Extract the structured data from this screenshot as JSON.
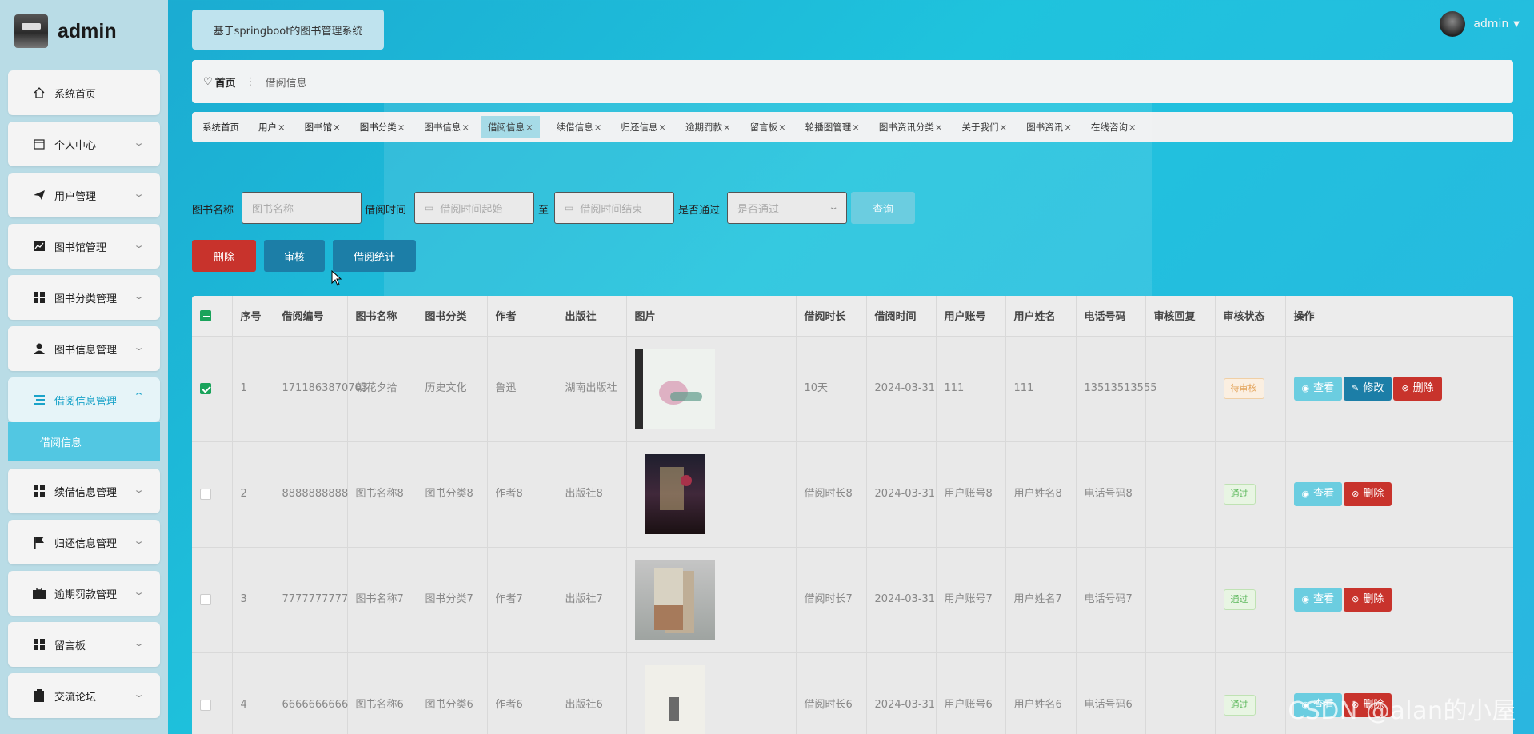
{
  "brand": {
    "name": "admin"
  },
  "header": {
    "system_title": "基于springboot的图书管理系统",
    "user_name": "admin"
  },
  "sidebar": {
    "items": [
      {
        "label": "系统首页",
        "icon": "home-icon"
      },
      {
        "label": "个人中心",
        "icon": "calendar-icon"
      },
      {
        "label": "用户管理",
        "icon": "send-icon"
      },
      {
        "label": "图书馆管理",
        "icon": "chart-icon"
      },
      {
        "label": "图书分类管理",
        "icon": "grid-icon"
      },
      {
        "label": "图书信息管理",
        "icon": "user-icon"
      },
      {
        "label": "借阅信息管理",
        "icon": "list-icon"
      },
      {
        "label": "续借信息管理",
        "icon": "grid-icon"
      },
      {
        "label": "归还信息管理",
        "icon": "flag-icon"
      },
      {
        "label": "逾期罚款管理",
        "icon": "briefcase-icon"
      },
      {
        "label": "留言板",
        "icon": "grid-icon"
      },
      {
        "label": "交流论坛",
        "icon": "clipboard-icon"
      }
    ],
    "active_sub": "借阅信息"
  },
  "breadcrumb": {
    "home": "首页",
    "current": "借阅信息"
  },
  "tags": [
    {
      "label": "系统首页",
      "closable": false
    },
    {
      "label": "用户",
      "closable": true
    },
    {
      "label": "图书馆",
      "closable": true
    },
    {
      "label": "图书分类",
      "closable": true
    },
    {
      "label": "图书信息",
      "closable": true
    },
    {
      "label": "借阅信息",
      "closable": true,
      "active": true
    },
    {
      "label": "续借信息",
      "closable": true
    },
    {
      "label": "归还信息",
      "closable": true
    },
    {
      "label": "逾期罚款",
      "closable": true
    },
    {
      "label": "留言板",
      "closable": true
    },
    {
      "label": "轮播图管理",
      "closable": true
    },
    {
      "label": "图书资讯分类",
      "closable": true
    },
    {
      "label": "关于我们",
      "closable": true
    },
    {
      "label": "图书资讯",
      "closable": true
    },
    {
      "label": "在线咨询",
      "closable": true
    }
  ],
  "search": {
    "book_name_label": "图书名称",
    "book_name_placeholder": "图书名称",
    "borrow_time_label": "借阅时间",
    "borrow_start_placeholder": "借阅时间起始",
    "to_label": "至",
    "borrow_end_placeholder": "借阅时间结束",
    "passed_label": "是否通过",
    "passed_placeholder": "是否通过",
    "query_label": "查询"
  },
  "actions": {
    "delete": "删除",
    "audit": "审核",
    "stats": "借阅统计"
  },
  "table": {
    "headers": [
      "序号",
      "借阅编号",
      "图书名称",
      "图书分类",
      "作者",
      "出版社",
      "图片",
      "借阅时长",
      "借阅时间",
      "用户账号",
      "用户姓名",
      "电话号码",
      "审核回复",
      "审核状态",
      "操作"
    ],
    "ops": {
      "view": "查看",
      "edit": "修改",
      "delete": "删除"
    },
    "rows": [
      {
        "index": "1",
        "borrow_no": "1711863870703",
        "book_name": "朝花夕拾",
        "category": "历史文化",
        "author": "鲁迅",
        "publisher": "湖南出版社",
        "duration": "10天",
        "borrow_time": "2024-03-31",
        "account": "111",
        "user_name": "111",
        "phone": "13513513555",
        "reply": "",
        "status": "待审核",
        "status_type": "pending",
        "checked": true,
        "editable": true
      },
      {
        "index": "2",
        "borrow_no": "8888888888",
        "book_name": "图书名称8",
        "category": "图书分类8",
        "author": "作者8",
        "publisher": "出版社8",
        "duration": "借阅时长8",
        "borrow_time": "2024-03-31",
        "account": "用户账号8",
        "user_name": "用户姓名8",
        "phone": "电话号码8",
        "reply": "",
        "status": "通过",
        "status_type": "pass",
        "checked": false,
        "editable": false
      },
      {
        "index": "3",
        "borrow_no": "7777777777",
        "book_name": "图书名称7",
        "category": "图书分类7",
        "author": "作者7",
        "publisher": "出版社7",
        "duration": "借阅时长7",
        "borrow_time": "2024-03-31",
        "account": "用户账号7",
        "user_name": "用户姓名7",
        "phone": "电话号码7",
        "reply": "",
        "status": "通过",
        "status_type": "pass",
        "checked": false,
        "editable": false
      },
      {
        "index": "4",
        "borrow_no": "6666666666",
        "book_name": "图书名称6",
        "category": "图书分类6",
        "author": "作者6",
        "publisher": "出版社6",
        "duration": "借阅时长6",
        "borrow_time": "2024-03-31",
        "account": "用户账号6",
        "user_name": "用户姓名6",
        "phone": "电话号码6",
        "reply": "",
        "status": "通过",
        "status_type": "pass",
        "checked": false,
        "editable": false
      }
    ]
  },
  "watermark": "CSDN @alan的小屋"
}
